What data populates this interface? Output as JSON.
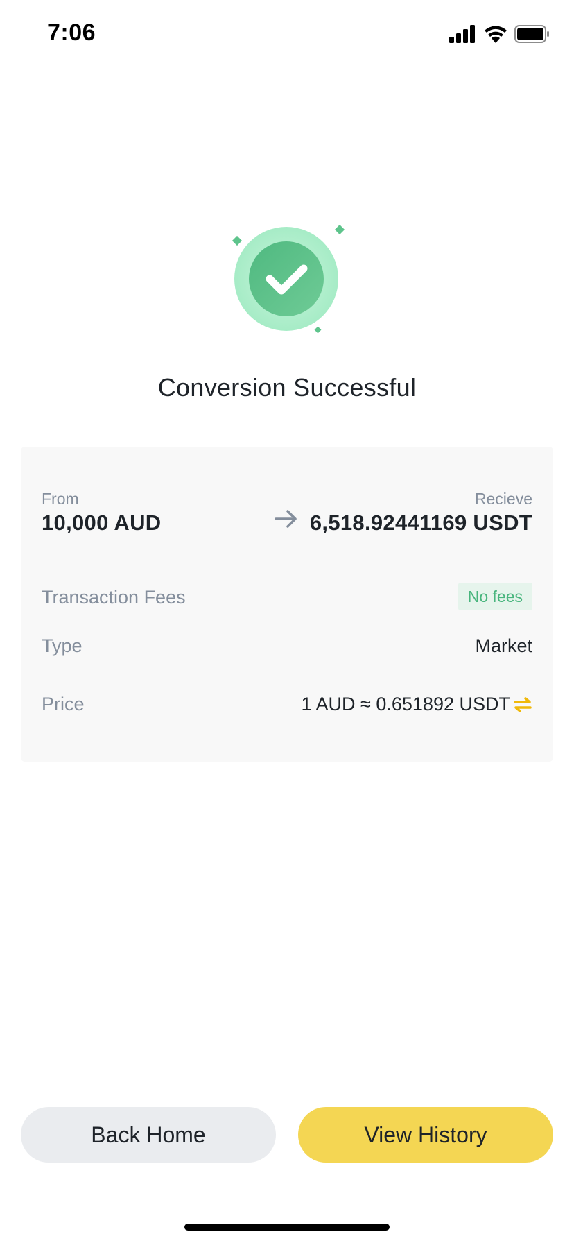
{
  "status_bar": {
    "time": "7:06"
  },
  "hero": {
    "icon": "success-check-icon",
    "accent_color": "#5ec48c"
  },
  "title": "Conversion Successful",
  "card": {
    "from_label": "From",
    "from_value": "10,000 AUD",
    "receive_label": "Recieve",
    "receive_value": "6,518.92441169 USDT",
    "fees_label": "Transaction Fees",
    "fees_value": "No fees",
    "type_label": "Type",
    "type_value": "Market",
    "price_label": "Price",
    "price_value": "1 AUD ≈ 0.651892 USDT"
  },
  "buttons": {
    "back_home": "Back Home",
    "view_history": "View History"
  },
  "colors": {
    "primary_yellow": "#f4d653",
    "secondary_grey": "#eaecef",
    "success_green": "#48b57d"
  }
}
